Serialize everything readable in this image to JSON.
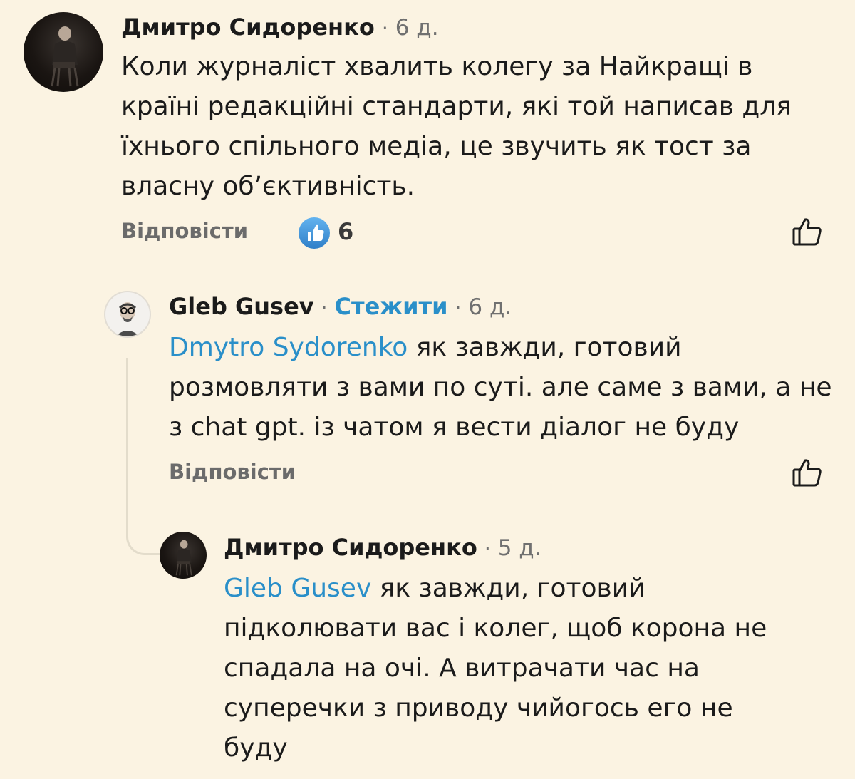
{
  "comments": [
    {
      "author": "Дмитро Сидоренко",
      "time": "6 д.",
      "text": "Коли журналіст хвалить колегу за Найкращі в країні редакційні стандарти, які той написав для їхнього спільного медіа, це звучить як тост за власну обʼєктивність.",
      "reply_label": "Відповісти",
      "reactions_count": "6",
      "avatar_icon": "person-photo-dark",
      "reaction_icon": "thumbs-up-badge-icon",
      "like_icon": "thumbs-up-outline-icon"
    },
    {
      "author": "Gleb Gusev",
      "follow_label": "Стежити",
      "time": "6 д.",
      "mention": "Dmytro  Sydorenko",
      "text": " як завжди, готовий розмовляти з вами по суті. але саме з вами, а не з chat gpt. із чатом я вести діалог не буду",
      "reply_label": "Відповісти",
      "avatar_icon": "person-photo-light",
      "like_icon": "thumbs-up-outline-icon"
    },
    {
      "author": "Дмитро Сидоренко",
      "time": "5 д.",
      "mention": "Gleb Gusev",
      "text": " як завжди, готовий підколювати вас і колег, щоб корона не спадала на очі. А витрачати час на суперечки з приводу чийогось его не буду",
      "avatar_icon": "person-photo-dark"
    }
  ],
  "colors": {
    "background": "#fbf3e2",
    "link": "#2a8fc9",
    "reaction_badge": "#3d8fd6",
    "muted": "#707070"
  }
}
